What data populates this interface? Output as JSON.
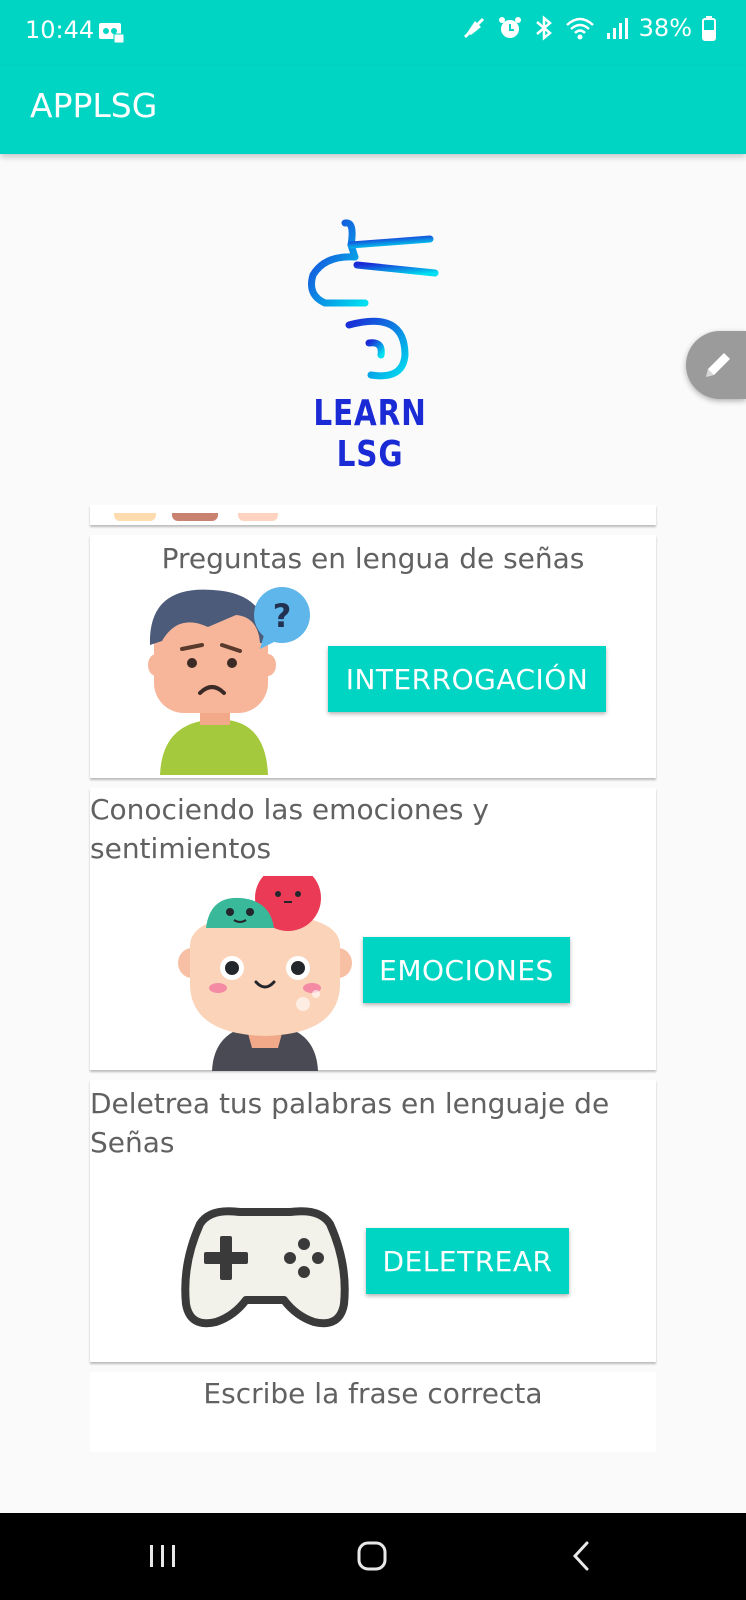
{
  "status_bar": {
    "time": "10:44",
    "battery": "38%",
    "icons": [
      "voicemail-icon",
      "mute-icon",
      "alarm-icon",
      "bluetooth-icon",
      "wifi-icon",
      "signal-icon",
      "battery-icon"
    ]
  },
  "app_bar": {
    "title": "APPLSG"
  },
  "logo": {
    "text": "LEARN LSG"
  },
  "fab": {
    "icon": "edit-icon"
  },
  "cards": [
    {
      "title": "Preguntas en lengua de señas",
      "button": "INTERROGACIÓN",
      "image": "confused-boy-icon"
    },
    {
      "title": "Conociendo las emociones y sentimientos",
      "button": "EMOCIONES",
      "image": "emotions-head-icon"
    },
    {
      "title": "Deletrea tus palabras en lenguaje de Señas",
      "button": "DELETREAR",
      "image": "gamepad-icon"
    },
    {
      "title": "Escribe la frase correcta"
    }
  ],
  "colors": {
    "primary": "#00d5c3",
    "logo_blue": "#1a2bd6",
    "background": "#fafafa"
  },
  "nav_bar": {
    "icons": [
      "recent-apps-icon",
      "home-icon",
      "back-icon"
    ]
  }
}
